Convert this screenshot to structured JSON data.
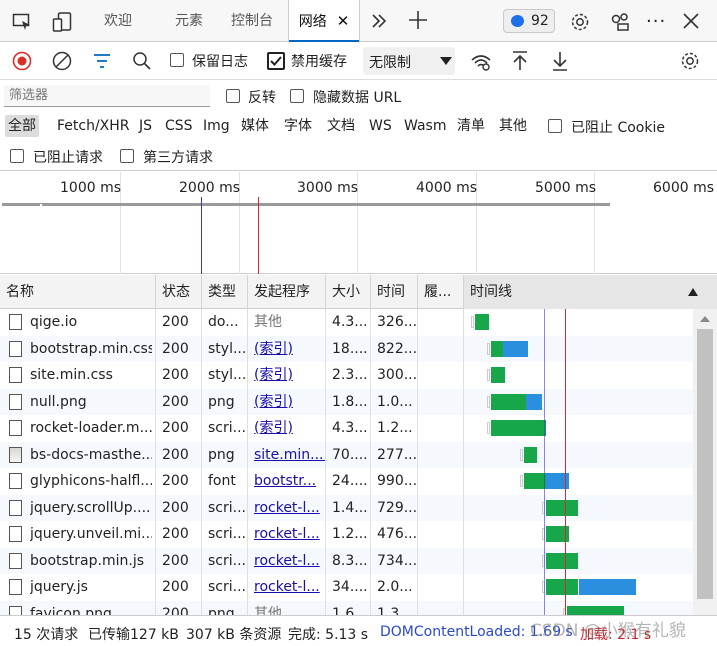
{
  "tabs": [
    {
      "label": "欢迎"
    },
    {
      "label": "元素"
    },
    {
      "label": "控制台"
    },
    {
      "label": "网络",
      "active": true
    }
  ],
  "issues_count": "92",
  "toolbar": {
    "preserve_log": "保留日志",
    "disable_cache": "禁用缓存",
    "disable_cache_checked": true,
    "throttling": "无限制"
  },
  "filter": {
    "placeholder": "筛选器",
    "invert": "反转",
    "hide_data_urls": "隐藏数据 URL"
  },
  "type_filters": [
    "全部",
    "Fetch/XHR",
    "JS",
    "CSS",
    "Img",
    "媒体",
    "字体",
    "文档",
    "WS",
    "Wasm",
    "清单",
    "其他"
  ],
  "blocked_cookies": "已阻止 Cookie",
  "blocked_requests": "已阻止请求",
  "third_party": "第三方请求",
  "overview_ticks": [
    "1000 ms",
    "2000 ms",
    "3000 ms",
    "4000 ms",
    "5000 ms",
    "6000 ms"
  ],
  "columns": [
    "名称",
    "状态",
    "类型",
    "发起程序",
    "大小",
    "时间",
    "履...",
    "时间线"
  ],
  "requests": [
    {
      "name": "qige.io",
      "status": "200",
      "type": "do...",
      "initiator": "其他",
      "initiator_link": false,
      "size": "4.3...",
      "time": "326...",
      "icon": "doc",
      "bar": {
        "start": 0.05,
        "wait": 0.06,
        "dl": 0.0
      }
    },
    {
      "name": "bootstrap.min.css",
      "status": "200",
      "type": "styl...",
      "initiator": "(索引)",
      "initiator_link": true,
      "size": "18....",
      "time": "822...",
      "icon": "doc",
      "bar": {
        "start": 0.12,
        "wait": 0.05,
        "dl": 0.11
      }
    },
    {
      "name": "site.min.css",
      "status": "200",
      "type": "styl...",
      "initiator": "(索引)",
      "initiator_link": true,
      "size": "2.3...",
      "time": "300...",
      "icon": "doc",
      "bar": {
        "start": 0.12,
        "wait": 0.06,
        "dl": 0.0
      }
    },
    {
      "name": "null.png",
      "status": "200",
      "type": "png",
      "initiator": "(索引)",
      "initiator_link": true,
      "size": "1.8...",
      "time": "1.0...",
      "icon": "doc",
      "bar": {
        "start": 0.12,
        "wait": 0.15,
        "dl": 0.07
      }
    },
    {
      "name": "rocket-loader.m...",
      "status": "200",
      "type": "scri...",
      "initiator": "(索引)",
      "initiator_link": true,
      "size": "4.3...",
      "time": "1.2...",
      "icon": "doc",
      "bar": {
        "start": 0.12,
        "wait": 0.24,
        "dl": 0.0
      }
    },
    {
      "name": "bs-docs-masthe...",
      "status": "200",
      "type": "png",
      "initiator": "site.min....",
      "initiator_link": true,
      "size": "70....",
      "time": "277...",
      "icon": "img",
      "bar": {
        "start": 0.26,
        "wait": 0.06,
        "dl": 0.0
      }
    },
    {
      "name": "glyphicons-halfl...",
      "status": "200",
      "type": "font",
      "initiator": "bootstr...",
      "initiator_link": true,
      "size": "24....",
      "time": "990...",
      "icon": "doc",
      "bar": {
        "start": 0.26,
        "wait": 0.1,
        "dl": 0.1
      }
    },
    {
      "name": "jquery.scrollUp....",
      "status": "200",
      "type": "scri...",
      "initiator": "rocket-l...",
      "initiator_link": true,
      "size": "1.4...",
      "time": "729...",
      "icon": "doc",
      "bar": {
        "start": 0.36,
        "wait": 0.14,
        "dl": 0.0
      }
    },
    {
      "name": "jquery.unveil.mi...",
      "status": "200",
      "type": "scri...",
      "initiator": "rocket-l...",
      "initiator_link": true,
      "size": "1.2...",
      "time": "476...",
      "icon": "doc",
      "bar": {
        "start": 0.36,
        "wait": 0.1,
        "dl": 0.0
      }
    },
    {
      "name": "bootstrap.min.js",
      "status": "200",
      "type": "scri...",
      "initiator": "rocket-l...",
      "initiator_link": true,
      "size": "8.3...",
      "time": "734...",
      "icon": "doc",
      "bar": {
        "start": 0.36,
        "wait": 0.14,
        "dl": 0.0
      }
    },
    {
      "name": "jquery.js",
      "status": "200",
      "type": "scri...",
      "initiator": "rocket-l...",
      "initiator_link": true,
      "size": "34....",
      "time": "2.0...",
      "icon": "doc",
      "bar": {
        "start": 0.36,
        "wait": 0.14,
        "dl": 0.25
      }
    },
    {
      "name": "favicon.png",
      "status": "200",
      "type": "png",
      "initiator": "其他",
      "initiator_link": false,
      "size": "1.6...",
      "time": "1.3...",
      "icon": "doc",
      "bar": {
        "start": 0.45,
        "wait": 0.25,
        "dl": 0.0
      }
    }
  ],
  "timeline_markers": {
    "dom_content_loaded": 0.35,
    "load": 0.44
  },
  "status": {
    "requests": "15 次请求",
    "transferred": "已传输127 kB",
    "resources": "307 kB 条资源",
    "finish": "完成: 5.13 s",
    "dcl": "DOMContentLoaded: 1.69 s",
    "load": "加载: 2.1 s",
    "watermark": "CSDN @小猴有礼貌"
  },
  "colors": {
    "accent": "#0067c0",
    "record": "#d93025",
    "waiting": "#17a64a",
    "download": "#2b8fe0",
    "dcl_line": "#3a3ad0",
    "load_line": "#d42c2c"
  }
}
